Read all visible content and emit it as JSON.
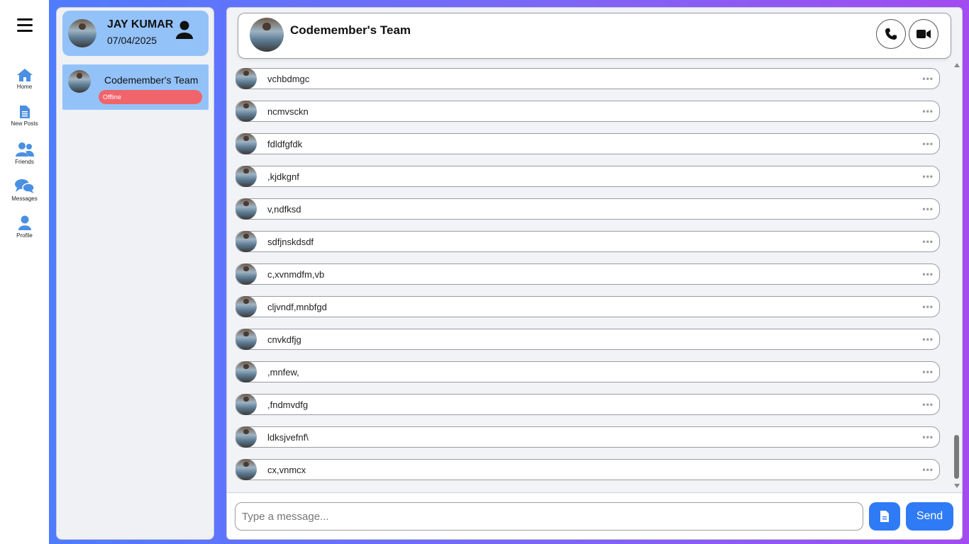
{
  "nav": {
    "items": [
      {
        "label": "Home",
        "icon": "home-icon"
      },
      {
        "label": "New Posts",
        "icon": "document-icon"
      },
      {
        "label": "Friends",
        "icon": "users-icon"
      },
      {
        "label": "Messages",
        "icon": "chat-bubbles-icon"
      },
      {
        "label": "Profile",
        "icon": "user-icon"
      }
    ],
    "accent": "#4a90e2"
  },
  "sidebar": {
    "user": {
      "name": "JAY KUMAR",
      "date": "07/04/2025"
    },
    "contacts": [
      {
        "name": "Codemember's Team",
        "status": "Offline"
      }
    ]
  },
  "chat": {
    "title": "Codemember's Team",
    "messages": [
      {
        "text": "vchbdmgc"
      },
      {
        "text": "ncmvsckn"
      },
      {
        "text": "fdldfgfdk"
      },
      {
        "text": ",kjdkgnf"
      },
      {
        "text": "v,ndfksd"
      },
      {
        "text": "sdfjnskdsdf"
      },
      {
        "text": "c,xvnmdfm,vb"
      },
      {
        "text": "cljvndf,mnbfgd"
      },
      {
        "text": "cnvkdfjg"
      },
      {
        "text": ",mnfew,"
      },
      {
        "text": ",fndmvdfg"
      },
      {
        "text": "ldksjvefnf\\"
      },
      {
        "text": "cx,vnmcx"
      }
    ],
    "more_glyph": "•••"
  },
  "composer": {
    "placeholder": "Type a message...",
    "send_label": "Send"
  },
  "colors": {
    "card": "#93c2f9",
    "offline": "#f0646b",
    "button": "#2f7bf5"
  }
}
